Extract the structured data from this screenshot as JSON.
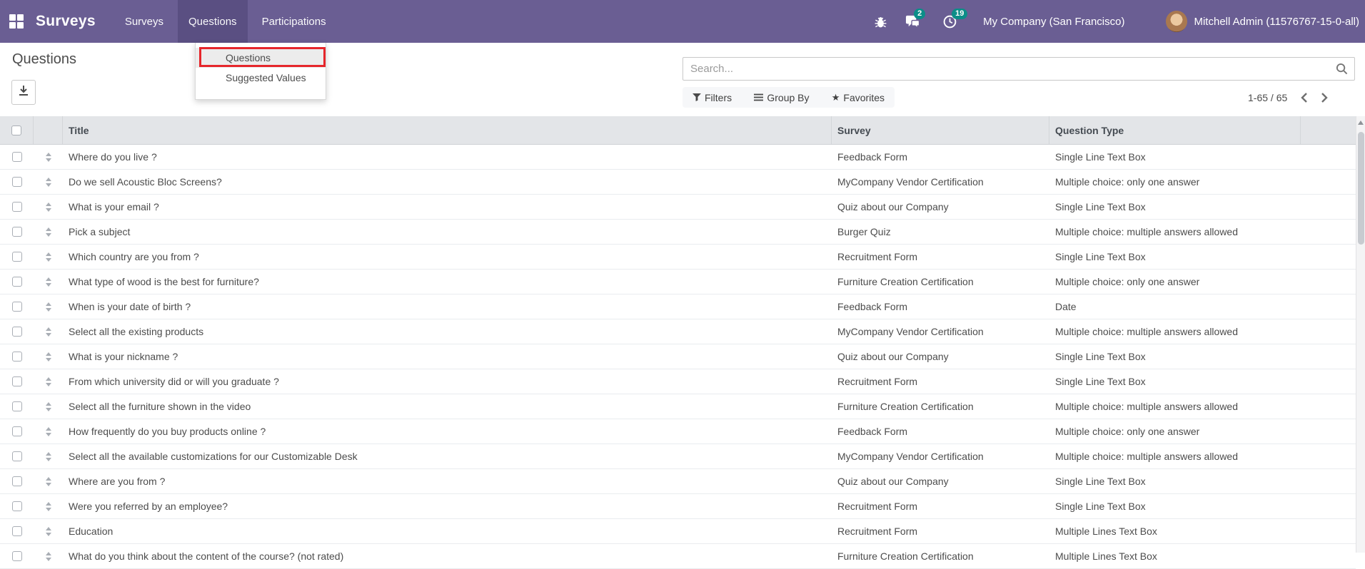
{
  "colors": {
    "navbar_bg": "#6a5e93",
    "navbar_active_bg": "#5a4f82",
    "badge_bg": "#0b8e88",
    "annotation_red": "#e6262b",
    "table_header_bg": "#e3e5e8"
  },
  "nav": {
    "brand": "Surveys",
    "menus": [
      {
        "label": "Surveys",
        "active": false
      },
      {
        "label": "Questions",
        "active": true
      },
      {
        "label": "Participations",
        "active": false
      }
    ],
    "systray": {
      "chat_badge": "2",
      "activity_badge": "19",
      "company": "My Company (San Francisco)",
      "user": "Mitchell Admin (11576767-15-0-all)"
    }
  },
  "menu_dropdown": {
    "items": [
      {
        "label": "Questions",
        "highlighted": true
      },
      {
        "label": "Suggested Values",
        "highlighted": false
      }
    ]
  },
  "page": {
    "title": "Questions"
  },
  "search": {
    "placeholder": "Search..."
  },
  "control_panel": {
    "filters": "Filters",
    "group_by": "Group By",
    "favorites": "Favorites",
    "pager_range": "1-65 / 65"
  },
  "table": {
    "columns": [
      "Title",
      "Survey",
      "Question Type"
    ],
    "rows": [
      {
        "title": "Where do you live ?",
        "survey": "Feedback Form",
        "type": "Single Line Text Box"
      },
      {
        "title": "Do we sell Acoustic Bloc Screens?",
        "survey": "MyCompany Vendor Certification",
        "type": "Multiple choice: only one answer"
      },
      {
        "title": "What is your email ?",
        "survey": "Quiz about our Company",
        "type": "Single Line Text Box"
      },
      {
        "title": "Pick a subject",
        "survey": "Burger Quiz",
        "type": "Multiple choice: multiple answers allowed"
      },
      {
        "title": "Which country are you from ?",
        "survey": "Recruitment Form",
        "type": "Single Line Text Box"
      },
      {
        "title": "What type of wood is the best for furniture?",
        "survey": "Furniture Creation Certification",
        "type": "Multiple choice: only one answer"
      },
      {
        "title": "When is your date of birth ?",
        "survey": "Feedback Form",
        "type": "Date"
      },
      {
        "title": "Select all the existing products",
        "survey": "MyCompany Vendor Certification",
        "type": "Multiple choice: multiple answers allowed"
      },
      {
        "title": "What is your nickname ?",
        "survey": "Quiz about our Company",
        "type": "Single Line Text Box"
      },
      {
        "title": "From which university did or will you graduate ?",
        "survey": "Recruitment Form",
        "type": "Single Line Text Box"
      },
      {
        "title": "Select all the furniture shown in the video",
        "survey": "Furniture Creation Certification",
        "type": "Multiple choice: multiple answers allowed"
      },
      {
        "title": "How frequently do you buy products online ?",
        "survey": "Feedback Form",
        "type": "Multiple choice: only one answer"
      },
      {
        "title": "Select all the available customizations for our Customizable Desk",
        "survey": "MyCompany Vendor Certification",
        "type": "Multiple choice: multiple answers allowed"
      },
      {
        "title": "Where are you from ?",
        "survey": "Quiz about our Company",
        "type": "Single Line Text Box"
      },
      {
        "title": "Were you referred by an employee?",
        "survey": "Recruitment Form",
        "type": "Single Line Text Box"
      },
      {
        "title": "Education",
        "survey": "Recruitment Form",
        "type": "Multiple Lines Text Box"
      },
      {
        "title": "What do you think about the content of the course? (not rated)",
        "survey": "Furniture Creation Certification",
        "type": "Multiple Lines Text Box"
      }
    ]
  }
}
